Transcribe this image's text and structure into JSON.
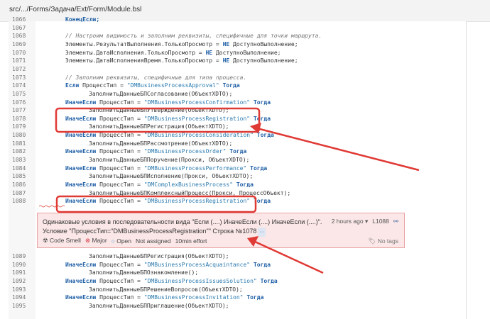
{
  "header": {
    "path": "src/.../Forms/Задача/Ext/Form/Module.bsl"
  },
  "code_before": [
    {
      "n": "1066",
      "i": 1,
      "tokens": [
        {
          "t": "kw",
          "v": "КонецЕсли;"
        }
      ]
    },
    {
      "n": "1067",
      "i": 1,
      "tokens": []
    },
    {
      "n": "1068",
      "i": 1,
      "tokens": [
        {
          "t": "cm",
          "v": "// Настроим видимость и заполним реквизиты, специфичные для точки маршрута."
        }
      ]
    },
    {
      "n": "1069",
      "i": 1,
      "tokens": [
        {
          "t": "tx",
          "v": "Элементы.РезультатВыполнения.ТолькоПросмотр = "
        },
        {
          "t": "kw",
          "v": "НЕ"
        },
        {
          "t": "tx",
          "v": " ДоступноВыполнение;"
        }
      ]
    },
    {
      "n": "1070",
      "i": 1,
      "tokens": [
        {
          "t": "tx",
          "v": "Элементы.ДатаИсполнения.ТолькоПросмотр = "
        },
        {
          "t": "kw",
          "v": "НЕ"
        },
        {
          "t": "tx",
          "v": " ДоступноВыполнение;"
        }
      ]
    },
    {
      "n": "1071",
      "i": 1,
      "tokens": [
        {
          "t": "tx",
          "v": "Элементы.ДатаИсполненияВремя.ТолькоПросмотр = "
        },
        {
          "t": "kw",
          "v": "НЕ"
        },
        {
          "t": "tx",
          "v": " ДоступноВыполнение;"
        }
      ]
    },
    {
      "n": "1072",
      "i": 1,
      "tokens": []
    },
    {
      "n": "1073",
      "i": 1,
      "tokens": [
        {
          "t": "cm",
          "v": "// Заполним реквизиты, специфичные для типа процесса."
        }
      ]
    },
    {
      "n": "1074",
      "i": 1,
      "tokens": [
        {
          "t": "kw",
          "v": "Если"
        },
        {
          "t": "tx",
          "v": " ПроцессТип = "
        },
        {
          "t": "str",
          "v": "\"DMBusinessProcessApproval\""
        },
        {
          "t": "tx",
          "v": " "
        },
        {
          "t": "kw",
          "v": "Тогда"
        }
      ]
    },
    {
      "n": "1075",
      "i": 2,
      "tokens": [
        {
          "t": "tx",
          "v": "ЗаполнитьДанныеБПСогласование(ОбъектXDTO);"
        }
      ]
    },
    {
      "n": "1076",
      "i": 1,
      "tokens": [
        {
          "t": "kw",
          "v": "ИначеЕсли"
        },
        {
          "t": "tx",
          "v": " ПроцессТип = "
        },
        {
          "t": "str",
          "v": "\"DMBusinessProcessConfirmation\""
        },
        {
          "t": "tx",
          "v": " "
        },
        {
          "t": "kw",
          "v": "Тогда"
        }
      ]
    },
    {
      "n": "1077",
      "i": 2,
      "tokens": [
        {
          "t": "tx",
          "v": "ЗаполнитьДанныеБПУтверждение(ОбъектXDTO);"
        }
      ]
    },
    {
      "n": "1078",
      "i": 1,
      "tokens": [
        {
          "t": "kw",
          "v": "ИначеЕсли"
        },
        {
          "t": "tx",
          "v": " ПроцессТип = "
        },
        {
          "t": "str",
          "v": "\"DMBusinessProcessRegistration\""
        },
        {
          "t": "tx",
          "v": " "
        },
        {
          "t": "kw",
          "v": "Тогда"
        }
      ]
    },
    {
      "n": "1079",
      "i": 2,
      "tokens": [
        {
          "t": "tx",
          "v": "ЗаполнитьДанныеБПРегистрация(ОбъектXDTO);"
        }
      ]
    },
    {
      "n": "1080",
      "i": 1,
      "tokens": [
        {
          "t": "kw",
          "v": "ИначеЕсли"
        },
        {
          "t": "tx",
          "v": " ПроцессТип = "
        },
        {
          "t": "str",
          "v": "\"DMBusinessProcessConsideration\""
        },
        {
          "t": "tx",
          "v": " "
        },
        {
          "t": "kw",
          "v": "Тогда"
        }
      ]
    },
    {
      "n": "1081",
      "i": 2,
      "tokens": [
        {
          "t": "tx",
          "v": "ЗаполнитьДанныеБПРассмотрение(ОбъектXDTO);"
        }
      ]
    },
    {
      "n": "1082",
      "i": 1,
      "tokens": [
        {
          "t": "kw",
          "v": "ИначеЕсли"
        },
        {
          "t": "tx",
          "v": " ПроцессТип = "
        },
        {
          "t": "str",
          "v": "\"DMBusinessProcessOrder\""
        },
        {
          "t": "tx",
          "v": " "
        },
        {
          "t": "kw",
          "v": "Тогда"
        }
      ]
    },
    {
      "n": "1083",
      "i": 2,
      "tokens": [
        {
          "t": "tx",
          "v": "ЗаполнитьДанныеБППоручение(Прокси, ОбъектXDTO);"
        }
      ]
    },
    {
      "n": "1084",
      "i": 1,
      "tokens": [
        {
          "t": "kw",
          "v": "ИначеЕсли"
        },
        {
          "t": "tx",
          "v": " ПроцессТип = "
        },
        {
          "t": "str",
          "v": "\"DMBusinessProcessPerformance\""
        },
        {
          "t": "tx",
          "v": " "
        },
        {
          "t": "kw",
          "v": "Тогда"
        }
      ]
    },
    {
      "n": "1085",
      "i": 2,
      "tokens": [
        {
          "t": "tx",
          "v": "ЗаполнитьДанныеБПИсполнение(Прокси, ОбъектXDTO);"
        }
      ]
    },
    {
      "n": "1086",
      "i": 1,
      "tokens": [
        {
          "t": "kw",
          "v": "ИначеЕсли"
        },
        {
          "t": "tx",
          "v": " ПроцессТип = "
        },
        {
          "t": "str",
          "v": "\"DMComplexBusinessProcess\""
        },
        {
          "t": "tx",
          "v": " "
        },
        {
          "t": "kw",
          "v": "Тогда"
        }
      ]
    },
    {
      "n": "1087",
      "i": 2,
      "tokens": [
        {
          "t": "tx",
          "v": "ЗаполнитьДанныеБПКомплексныйПроцесс(Прокси, ПроцессОбъект);"
        }
      ]
    },
    {
      "n": "1088",
      "i": 1,
      "tokens": [
        {
          "t": "kw",
          "v": "ИначеЕсли"
        },
        {
          "t": "tx",
          "v": " ПроцессТип = "
        },
        {
          "t": "str",
          "v": "\"DMBusinessProcessRegistration\""
        },
        {
          "t": "tx",
          "v": " "
        },
        {
          "t": "kw",
          "v": "Тогда"
        }
      ]
    }
  ],
  "code_after": [
    {
      "n": "1089",
      "i": 2,
      "tokens": [
        {
          "t": "tx",
          "v": "ЗаполнитьДанныеБПРегистрация(ОбъектXDTO);"
        }
      ]
    },
    {
      "n": "1090",
      "i": 1,
      "tokens": [
        {
          "t": "kw",
          "v": "ИначеЕсли"
        },
        {
          "t": "tx",
          "v": " ПроцессТип = "
        },
        {
          "t": "str",
          "v": "\"DMBusinessProcessAcquaintance\""
        },
        {
          "t": "tx",
          "v": " "
        },
        {
          "t": "kw",
          "v": "Тогда"
        }
      ]
    },
    {
      "n": "1091",
      "i": 2,
      "tokens": [
        {
          "t": "tx",
          "v": "ЗаполнитьДанныеБПОзнакомление();"
        }
      ]
    },
    {
      "n": "1092",
      "i": 1,
      "tokens": [
        {
          "t": "kw",
          "v": "ИначеЕсли"
        },
        {
          "t": "tx",
          "v": " ПроцессТип = "
        },
        {
          "t": "str",
          "v": "\"DMBusinessProcessIssuesSolution\""
        },
        {
          "t": "tx",
          "v": " "
        },
        {
          "t": "kw",
          "v": "Тогда"
        }
      ]
    },
    {
      "n": "1093",
      "i": 2,
      "tokens": [
        {
          "t": "tx",
          "v": "ЗаполнитьДанныеБПРешениеВопросов(ОбъектXDTO);"
        }
      ]
    },
    {
      "n": "1094",
      "i": 1,
      "tokens": [
        {
          "t": "kw",
          "v": "ИначеЕсли"
        },
        {
          "t": "tx",
          "v": " ПроцессТип = "
        },
        {
          "t": "str",
          "v": "\"DMBusinessProcessInvitation\""
        },
        {
          "t": "tx",
          "v": " "
        },
        {
          "t": "kw",
          "v": "Тогда"
        }
      ]
    },
    {
      "n": "1095",
      "i": 2,
      "tokens": [
        {
          "t": "tx",
          "v": "ЗаполнитьДанныеБППриглашение(ОбъектXDTO);"
        }
      ]
    }
  ],
  "issue": {
    "message_line1": "Одинаковые условия в последовательности вида \"Если (....) ИначеЕсли (....) ИначеЕсли (....)\".",
    "message_line2": "Условие \"ПроцессТип=\"DMBusinessProcessRegistration\"\" Строка №1078",
    "more": "···",
    "time": "2 hours ago",
    "line": "L1088",
    "type": "Code Smell",
    "severity": "Major",
    "status": "Open",
    "assignee": "Not assigned",
    "effort": "10min effort",
    "tags": "No tags",
    "icons": {
      "type": "code-smell-icon",
      "severity": "major-icon",
      "status": "open-icon",
      "link": "link-icon",
      "tags": "tag-icon"
    }
  },
  "colors": {
    "annotation": "#e03a35",
    "issue_bg": "#fbe7e7",
    "keyword": "#1f5fa6"
  }
}
